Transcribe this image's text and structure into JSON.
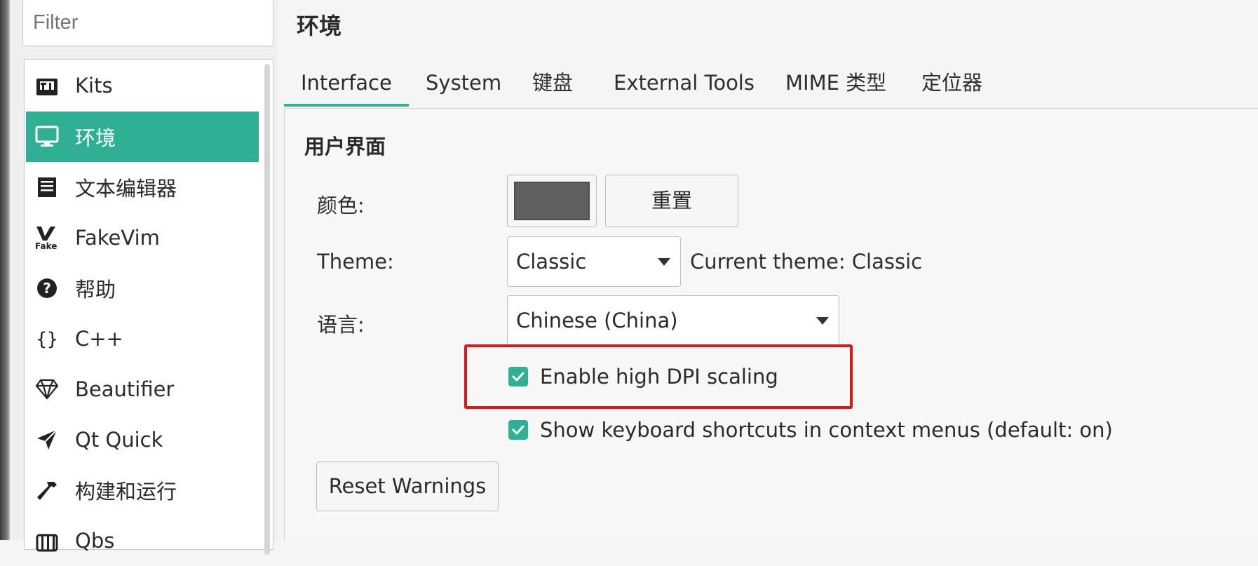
{
  "filter": {
    "placeholder": "Filter"
  },
  "sidebar": {
    "items": [
      {
        "label": "Kits",
        "icon": "kits-icon"
      },
      {
        "label": "环境",
        "icon": "monitor-icon",
        "selected": true
      },
      {
        "label": "文本编辑器",
        "icon": "text-editor-icon"
      },
      {
        "label": "FakeVim",
        "icon": "fakevim-icon"
      },
      {
        "label": "帮助",
        "icon": "help-icon"
      },
      {
        "label": "C++",
        "icon": "braces-icon"
      },
      {
        "label": "Beautifier",
        "icon": "diamond-icon"
      },
      {
        "label": "Qt Quick",
        "icon": "paper-plane-icon"
      },
      {
        "label": "构建和运行",
        "icon": "hammer-icon"
      },
      {
        "label": "Qbs",
        "icon": "qbs-icon"
      }
    ]
  },
  "page": {
    "title": "环境"
  },
  "tabs": [
    {
      "label": "Interface",
      "active": true
    },
    {
      "label": "System"
    },
    {
      "label": "键盘"
    },
    {
      "label": "External Tools"
    },
    {
      "label": "MIME 类型"
    },
    {
      "label": "定位器"
    }
  ],
  "group": {
    "title": "用户界面"
  },
  "form": {
    "color_label": "颜色:",
    "color_value": "#606060",
    "reset_label": "重置",
    "theme_label": "Theme:",
    "theme_value": "Classic",
    "current_theme": "Current theme: Classic",
    "language_label": "语言:",
    "language_value": "Chinese (China)",
    "high_dpi_label": "Enable high DPI scaling",
    "high_dpi_checked": true,
    "shortcuts_label": "Show keyboard shortcuts in context menus (default: on)",
    "shortcuts_checked": true,
    "reset_warnings_label": "Reset Warnings"
  },
  "colors": {
    "accent": "#2fb095",
    "highlight": "#e0141c"
  }
}
